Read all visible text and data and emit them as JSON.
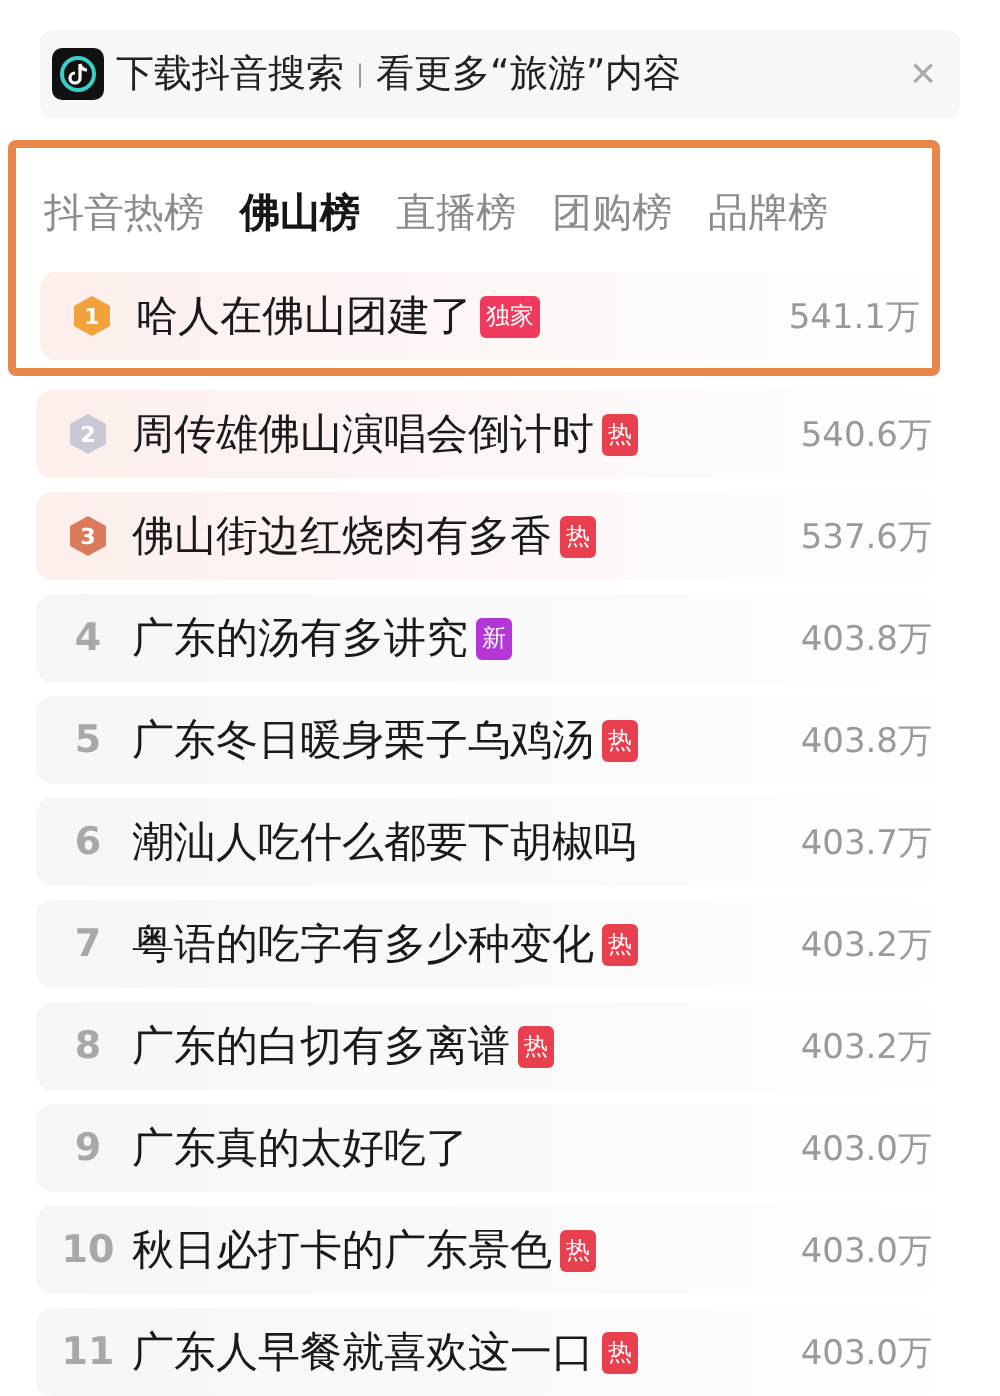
{
  "banner": {
    "title": "下载抖音搜索",
    "separator": "|",
    "subtitle": "看更多“旅游”内容",
    "close": "×"
  },
  "tabs": [
    {
      "label": "抖音热榜",
      "selected": false
    },
    {
      "label": "佛山榜",
      "selected": true
    },
    {
      "label": "直播榜",
      "selected": false
    },
    {
      "label": "团购榜",
      "selected": false
    },
    {
      "label": "品牌榜",
      "selected": false
    }
  ],
  "rows": [
    {
      "rank": "1",
      "kind": "medal",
      "color": "#f2a23a",
      "title": "哈人在佛山团建了",
      "tag": {
        "label": "独家",
        "color": "#ef3a5d"
      },
      "heat": "541.1万"
    },
    {
      "rank": "2",
      "kind": "medal",
      "color": "#c9c9d6",
      "title": "周传雄佛山演唱会倒计时",
      "tag": {
        "label": "热",
        "color": "#e8404f"
      },
      "heat": "540.6万"
    },
    {
      "rank": "3",
      "kind": "medal",
      "color": "#dc7a5c",
      "title": "佛山街边红烧肉有多香",
      "tag": {
        "label": "热",
        "color": "#e8404f"
      },
      "heat": "537.6万"
    },
    {
      "rank": "4",
      "kind": "number",
      "title": "广东的汤有多讲究",
      "tag": {
        "label": "新",
        "color": "#b536d6"
      },
      "heat": "403.8万"
    },
    {
      "rank": "5",
      "kind": "number",
      "title": "广东冬日暖身栗子乌鸡汤",
      "tag": {
        "label": "热",
        "color": "#e8404f"
      },
      "heat": "403.8万"
    },
    {
      "rank": "6",
      "kind": "number",
      "title": "潮汕人吃什么都要下胡椒吗",
      "heat": "403.7万"
    },
    {
      "rank": "7",
      "kind": "number",
      "title": "粤语的吃字有多少种变化",
      "tag": {
        "label": "热",
        "color": "#e8404f"
      },
      "heat": "403.2万"
    },
    {
      "rank": "8",
      "kind": "number",
      "title": "广东的白切有多离谱",
      "tag": {
        "label": "热",
        "color": "#e8404f"
      },
      "heat": "403.2万"
    },
    {
      "rank": "9",
      "kind": "number",
      "title": "广东真的太好吃了",
      "heat": "403.0万"
    },
    {
      "rank": "10",
      "kind": "number",
      "title": "秋日必打卡的广东景色",
      "tag": {
        "label": "热",
        "color": "#e8404f"
      },
      "heat": "403.0万"
    },
    {
      "rank": "11",
      "kind": "number",
      "title": "广东人早餐就喜欢这一口",
      "tag": {
        "label": "热",
        "color": "#e8404f"
      },
      "heat": "403.0万"
    }
  ]
}
